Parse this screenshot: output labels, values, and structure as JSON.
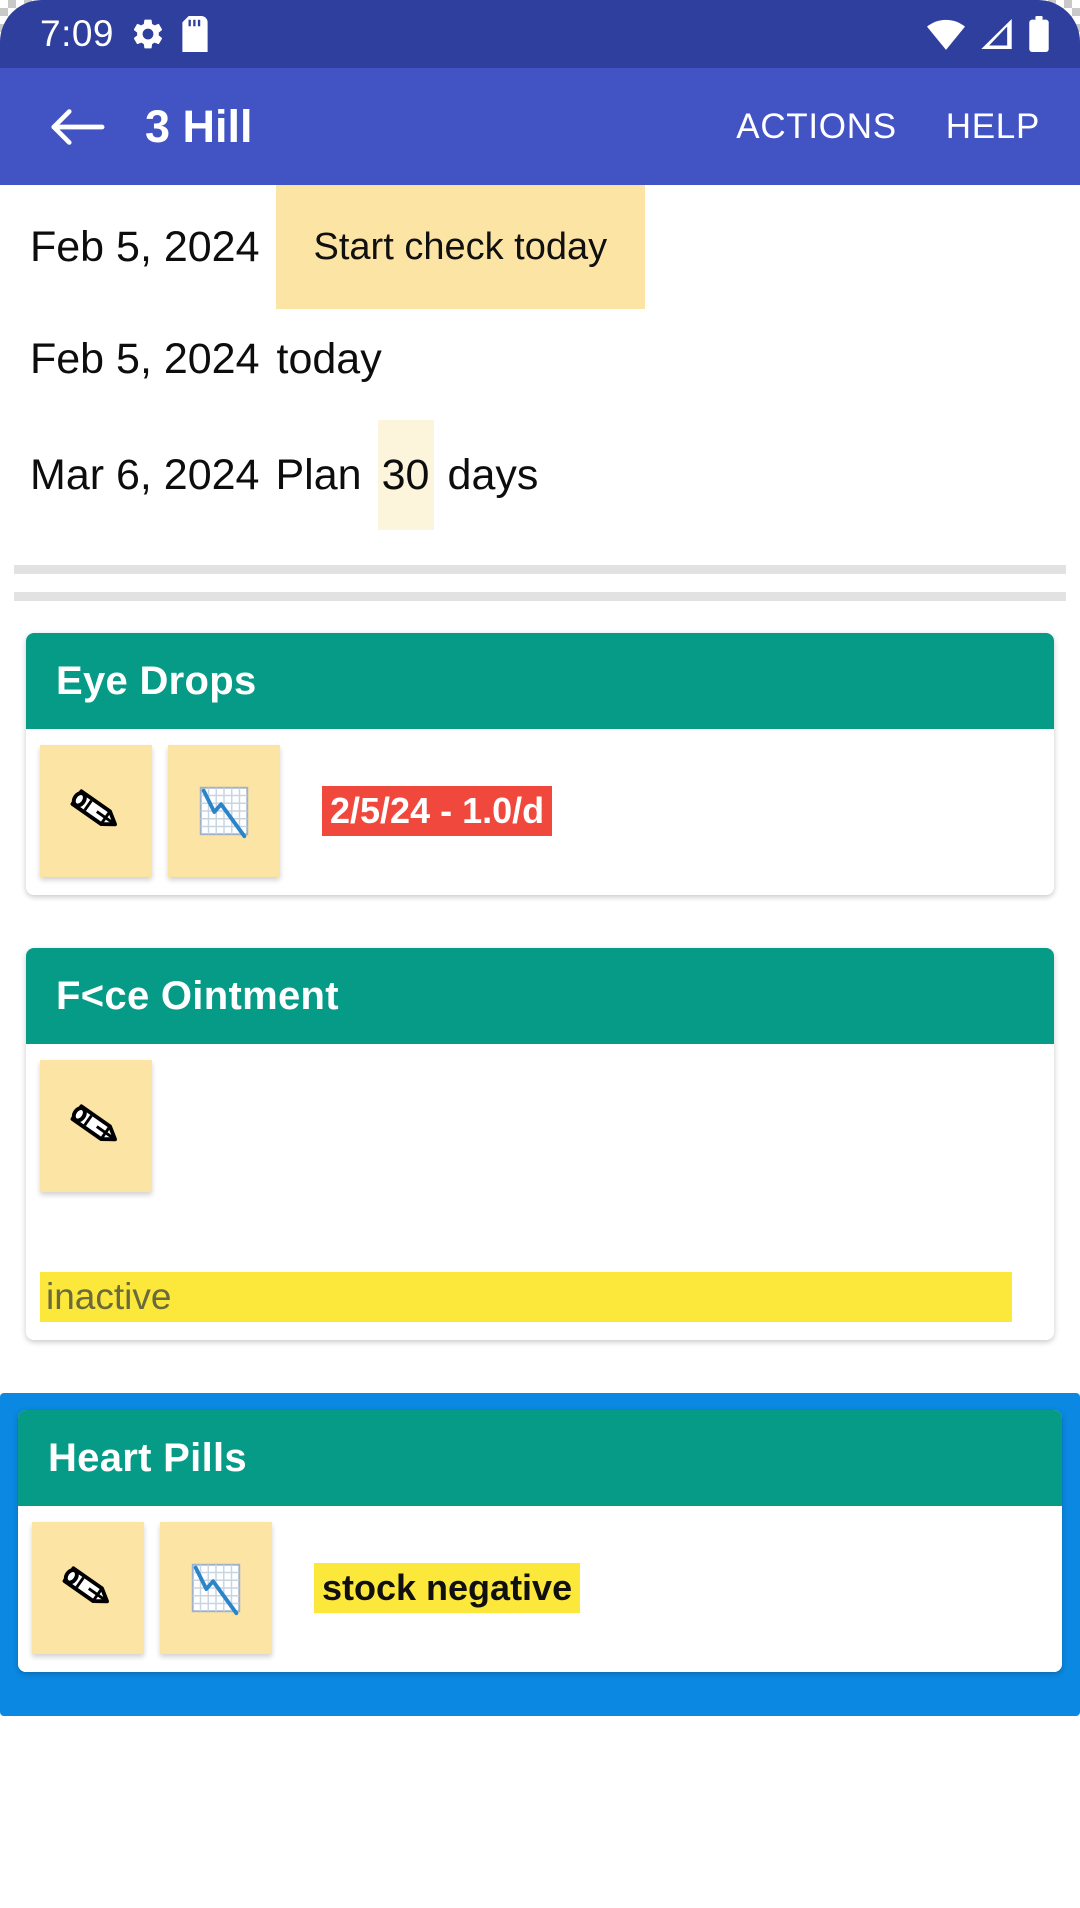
{
  "status_bar": {
    "time": "7:09",
    "icons": [
      "gear-icon",
      "sd-card-icon",
      "wifi-icon",
      "cellular-signal-icon",
      "battery-icon"
    ]
  },
  "app_bar": {
    "back_icon": "back-arrow-icon",
    "title": "3 Hill",
    "actions_label": "ACTIONS",
    "help_label": "HELP"
  },
  "plan": {
    "row1": {
      "date": "Feb 5, 2024",
      "chip": "Start check today"
    },
    "row2": {
      "date": "Feb 5, 2024",
      "label": "today"
    },
    "row3": {
      "date": "Mar 6, 2024",
      "plan_label": "Plan",
      "days_value": "30",
      "days_label": "days"
    }
  },
  "cards": [
    {
      "title": "Eye Drops",
      "icons": [
        "pencil-icon",
        "chart-down-icon"
      ],
      "badge": {
        "text": "2/5/24 - 1.0/d",
        "style": "red"
      },
      "selected": false,
      "inactive_bar": null
    },
    {
      "title": "F<ce Ointment",
      "icons": [
        "pencil-icon"
      ],
      "badge": null,
      "selected": false,
      "inactive_bar": "inactive"
    },
    {
      "title": "Heart Pills",
      "icons": [
        "pencil-icon",
        "chart-down-icon"
      ],
      "badge": {
        "text": "stock negative",
        "style": "yellow"
      },
      "selected": true,
      "inactive_bar": null
    }
  ],
  "colors": {
    "status_bar_bg": "#2f3f9e",
    "app_bar_bg": "#4253c3",
    "card_header_teal": "#059b87",
    "selection_blue": "#0b88e2",
    "tile_cream": "#fce4a4",
    "badge_red": "#f0483c",
    "badge_yellow": "#fbe83a",
    "chip_cream": "#fdf4dc"
  }
}
